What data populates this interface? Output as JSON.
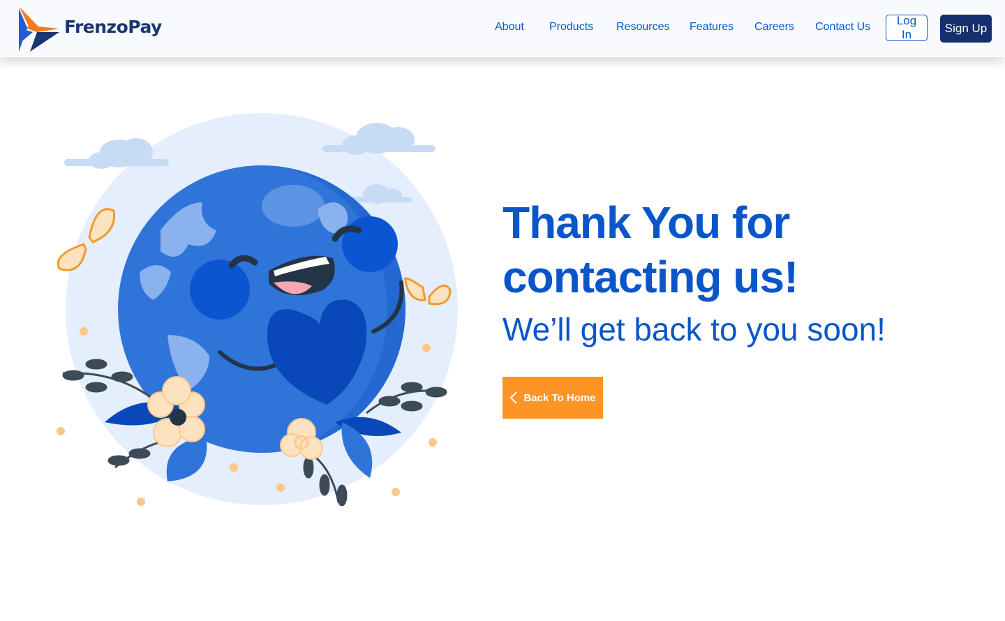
{
  "brand": {
    "name": "FrenzoPay"
  },
  "nav": {
    "items": [
      {
        "label": "About"
      },
      {
        "label": "Products"
      },
      {
        "label": "Resources"
      },
      {
        "label": "Features"
      },
      {
        "label": "Careers"
      },
      {
        "label": "Contact Us"
      }
    ],
    "login_label": "Log In",
    "signup_label": "Sign Up"
  },
  "hero": {
    "headline": "Thank You for contacting us!",
    "subline": "We’ll get back to you soon!",
    "cta_label": "Back To Home",
    "cta_icon": "chevron-left-icon",
    "illustration": "smiling-earth-holding-heart-illustration"
  },
  "colors": {
    "brand_blue": "#0a56c9",
    "navy": "#162f6e",
    "accent_orange": "#fd9426",
    "header_bg": "#f8fafd"
  }
}
